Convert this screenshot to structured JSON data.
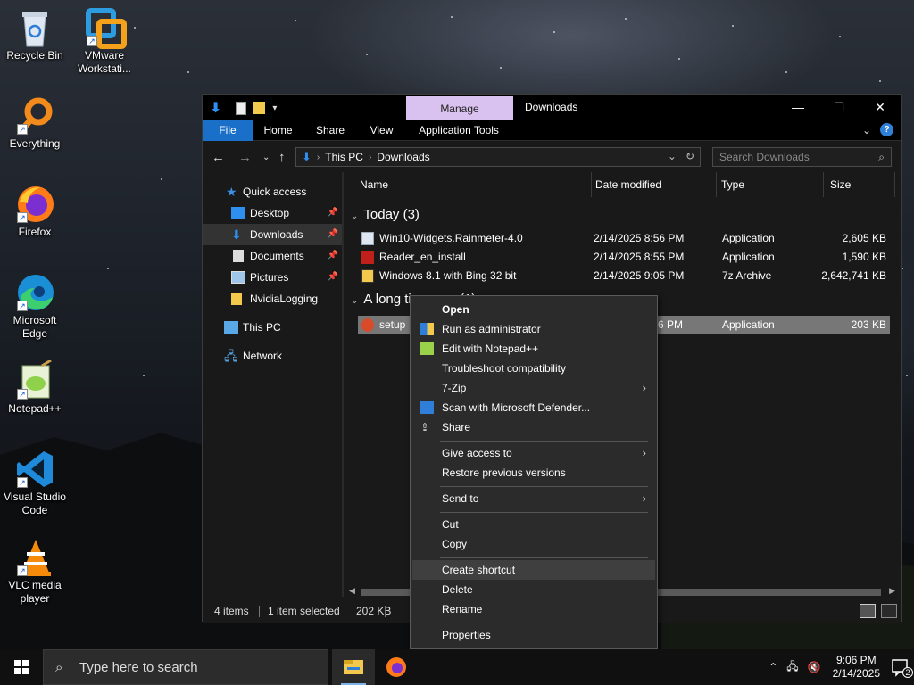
{
  "desktop": {
    "icons": [
      {
        "label": "Recycle Bin"
      },
      {
        "label": "VMware Workstati..."
      },
      {
        "label": "Everything"
      },
      {
        "label": "Firefox"
      },
      {
        "label": "Microsoft Edge"
      },
      {
        "label": "Notepad++"
      },
      {
        "label": "Visual Studio Code"
      },
      {
        "label": "VLC media player"
      }
    ]
  },
  "explorer": {
    "title": "Downloads",
    "manage_tab": "Manage",
    "ribbon_tabs": {
      "file": "File",
      "home": "Home",
      "share": "Share",
      "view": "View",
      "app_tools": "Application Tools"
    },
    "address": {
      "crumb1": "This PC",
      "crumb2": "Downloads"
    },
    "search_placeholder": "Search Downloads",
    "nav": {
      "quick_access": "Quick access",
      "desktop": "Desktop",
      "downloads": "Downloads",
      "documents": "Documents",
      "pictures": "Pictures",
      "nvidialogging": "NvidiaLogging",
      "this_pc": "This PC",
      "network": "Network"
    },
    "columns": {
      "name": "Name",
      "date": "Date modified",
      "type": "Type",
      "size": "Size"
    },
    "groups": {
      "today": "Today (3)",
      "long_ago": "A long time ago (1)"
    },
    "files": [
      {
        "name": "Win10-Widgets.Rainmeter-4.0",
        "date": "2/14/2025 8:56 PM",
        "type": "Application",
        "size": "2,605 KB"
      },
      {
        "name": "Reader_en_install",
        "date": "2/14/2025 8:55 PM",
        "type": "Application",
        "size": "1,590 KB"
      },
      {
        "name": "Windows 8.1 with Bing 32 bit",
        "date": "2/14/2025 9:05 PM",
        "type": "7z Archive",
        "size": "2,642,741 KB"
      },
      {
        "name": "setup",
        "date": "6 PM",
        "type": "Application",
        "size": "203 KB"
      }
    ],
    "status": {
      "items": "4 items",
      "selected": "1 item selected",
      "size": "202 KB"
    }
  },
  "context_menu": {
    "open": "Open",
    "run_admin": "Run as administrator",
    "edit_npp": "Edit with Notepad++",
    "troubleshoot": "Troubleshoot compatibility",
    "sevenzip": "7-Zip",
    "defender": "Scan with Microsoft Defender...",
    "share": "Share",
    "give_access": "Give access to",
    "restore": "Restore previous versions",
    "send_to": "Send to",
    "cut": "Cut",
    "copy": "Copy",
    "create_shortcut": "Create shortcut",
    "delete": "Delete",
    "rename": "Rename",
    "properties": "Properties"
  },
  "taskbar": {
    "search_placeholder": "Type here to search",
    "time": "9:06 PM",
    "date": "2/14/2025",
    "notification_count": "2"
  },
  "colors": {
    "file_tab": "#1a6fc9",
    "manage_tab": "#d9c2ef",
    "selection": "#777777",
    "menu_bg": "#2b2b2b"
  }
}
